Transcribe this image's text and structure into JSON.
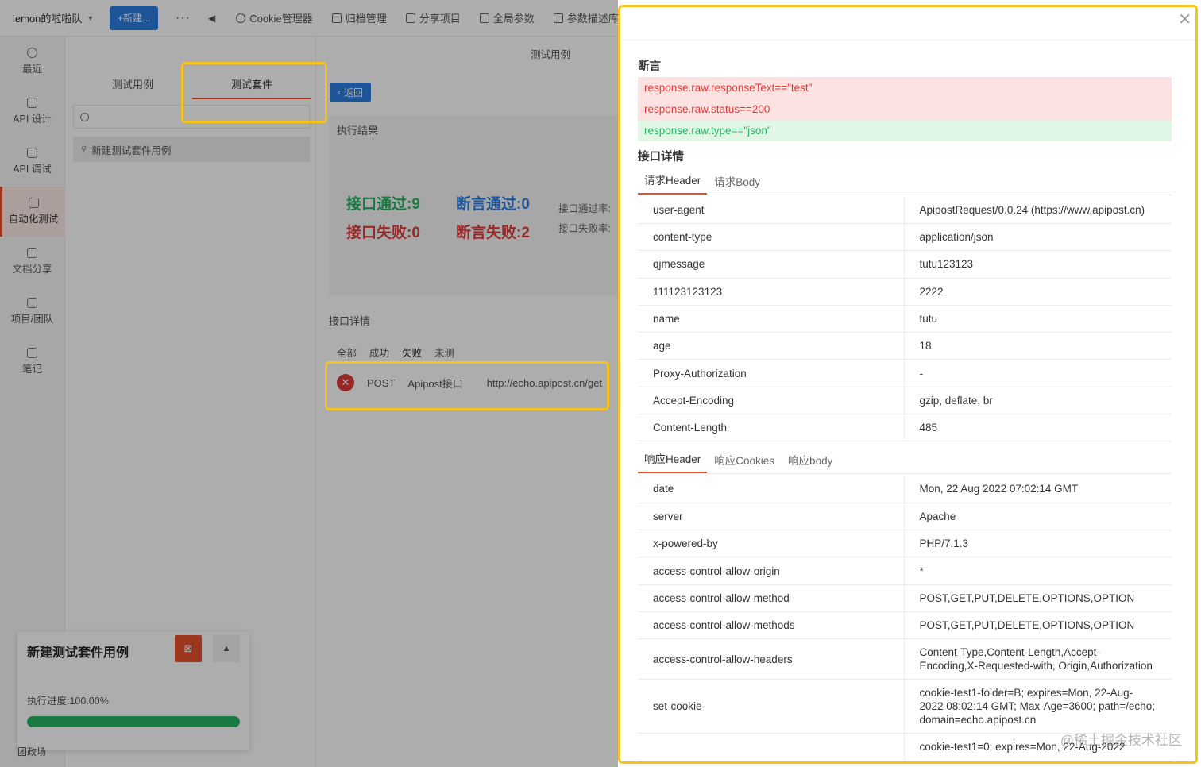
{
  "topbar": {
    "team": "lemon的啦啦队",
    "new_label": "+新建...",
    "more": "···",
    "items": [
      "Cookie管理器",
      "归档管理",
      "分享项目",
      "全局参数",
      "参数描述库"
    ]
  },
  "sidebar": {
    "items": [
      {
        "label": "最近",
        "icon": "clock-icon"
      },
      {
        "label": "API 设计",
        "icon": "edit-icon"
      },
      {
        "label": "API 调试",
        "icon": "link-icon"
      },
      {
        "label": "自动化测试",
        "icon": "flow-icon"
      },
      {
        "label": "文档分享",
        "icon": "doc-icon"
      },
      {
        "label": "项目/团队",
        "icon": "folder-icon"
      },
      {
        "label": "笔记",
        "icon": "note-icon"
      }
    ]
  },
  "left_panel": {
    "tabs": [
      "测试用例",
      "测试套件"
    ],
    "suite_item": "新建测试套件用例"
  },
  "main": {
    "head": "测试用例",
    "back": "返回",
    "result_title": "执行结果",
    "api_pass": "接口通过:9",
    "assert_pass": "断言通过:0",
    "api_fail": "接口失败:0",
    "assert_fail": "断言失败:2",
    "pass_rate": "接口通过率:",
    "fail_rate": "接口失败率:",
    "api_detail_title": "接口详情",
    "filters": [
      "全部",
      "成功",
      "失败",
      "未测"
    ],
    "row": {
      "method": "POST",
      "name": "Apipost接口",
      "url": "http://echo.apipost.cn/get"
    }
  },
  "float_card": {
    "title": "新建测试套件用例",
    "progress_label": "执行进度:100.00%",
    "progress": 1.0,
    "bottom_text": "团政场"
  },
  "drawer": {
    "assert_title": "断言",
    "assertions": [
      {
        "text": "response.raw.responseText==\"test\"",
        "status": "fail"
      },
      {
        "text": "response.raw.status==200",
        "status": "fail"
      },
      {
        "text": "response.raw.type==\"json\"",
        "status": "pass"
      }
    ],
    "detail_title": "接口详情",
    "req_tabs": [
      "请求Header",
      "请求Body"
    ],
    "req_headers": [
      [
        "user-agent",
        "ApipostRequest/0.0.24 (https://www.apipost.cn)"
      ],
      [
        "content-type",
        "application/json"
      ],
      [
        "qjmessage",
        "tutu123123"
      ],
      [
        "111123123123",
        "2222"
      ],
      [
        "name",
        "tutu"
      ],
      [
        "age",
        "18"
      ],
      [
        "Proxy-Authorization",
        "-"
      ],
      [
        "Accept-Encoding",
        "gzip, deflate, br"
      ],
      [
        "Content-Length",
        "485"
      ]
    ],
    "res_tabs": [
      "响应Header",
      "响应Cookies",
      "响应body"
    ],
    "res_headers": [
      [
        "date",
        "Mon, 22 Aug 2022 07:02:14 GMT"
      ],
      [
        "server",
        "Apache"
      ],
      [
        "x-powered-by",
        "PHP/7.1.3"
      ],
      [
        "access-control-allow-origin",
        "*"
      ],
      [
        "access-control-allow-method",
        "POST,GET,PUT,DELETE,OPTIONS,OPTION"
      ],
      [
        "access-control-allow-methods",
        "POST,GET,PUT,DELETE,OPTIONS,OPTION"
      ],
      [
        "access-control-allow-headers",
        "Content-Type,Content-Length,Accept-Encoding,X-Requested-with, Origin,Authorization"
      ],
      [
        "set-cookie",
        "cookie-test1-folder=B; expires=Mon, 22-Aug-2022 08:02:14 GMT; Max-Age=3600; path=/echo; domain=echo.apipost.cn"
      ],
      [
        "",
        "cookie-test1=0; expires=Mon, 22-Aug-2022"
      ]
    ],
    "watermark": "@稀土掘金技术社区"
  },
  "colors": {
    "accent": "#e6522c",
    "primary": "#2d7de0",
    "success": "#28b463",
    "danger": "#e03b3b",
    "highlight": "#f7c21e"
  }
}
